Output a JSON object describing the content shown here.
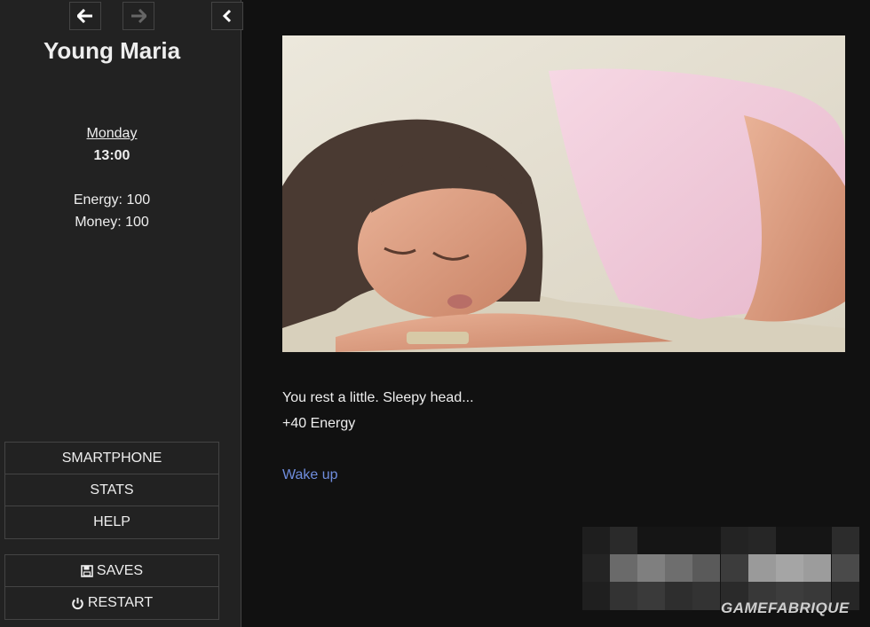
{
  "sidebar": {
    "back_icon": "arrow-left-icon",
    "forward_icon": "arrow-right-icon",
    "collapse_icon": "chevron-left-icon",
    "title": "Young Maria",
    "day": "Monday",
    "time": "13:00",
    "energy": "Energy: 100",
    "money": "Money: 100",
    "menu": [
      {
        "label": "SMARTPHONE"
      },
      {
        "label": "STATS"
      },
      {
        "label": "HELP"
      }
    ],
    "menu2": [
      {
        "label": "SAVES",
        "icon": "floppy-disk-icon"
      },
      {
        "label": "RESTART",
        "icon": "power-icon"
      }
    ]
  },
  "passage": {
    "line1": "You rest a little. Sleepy head...",
    "line2": "+40 Energy",
    "link": "Wake up"
  },
  "watermark": "GAMEFABRIQUE",
  "colors": {
    "background": "#111111",
    "sidebar": "#222222",
    "link": "#6f8ddd",
    "border": "#444444"
  }
}
